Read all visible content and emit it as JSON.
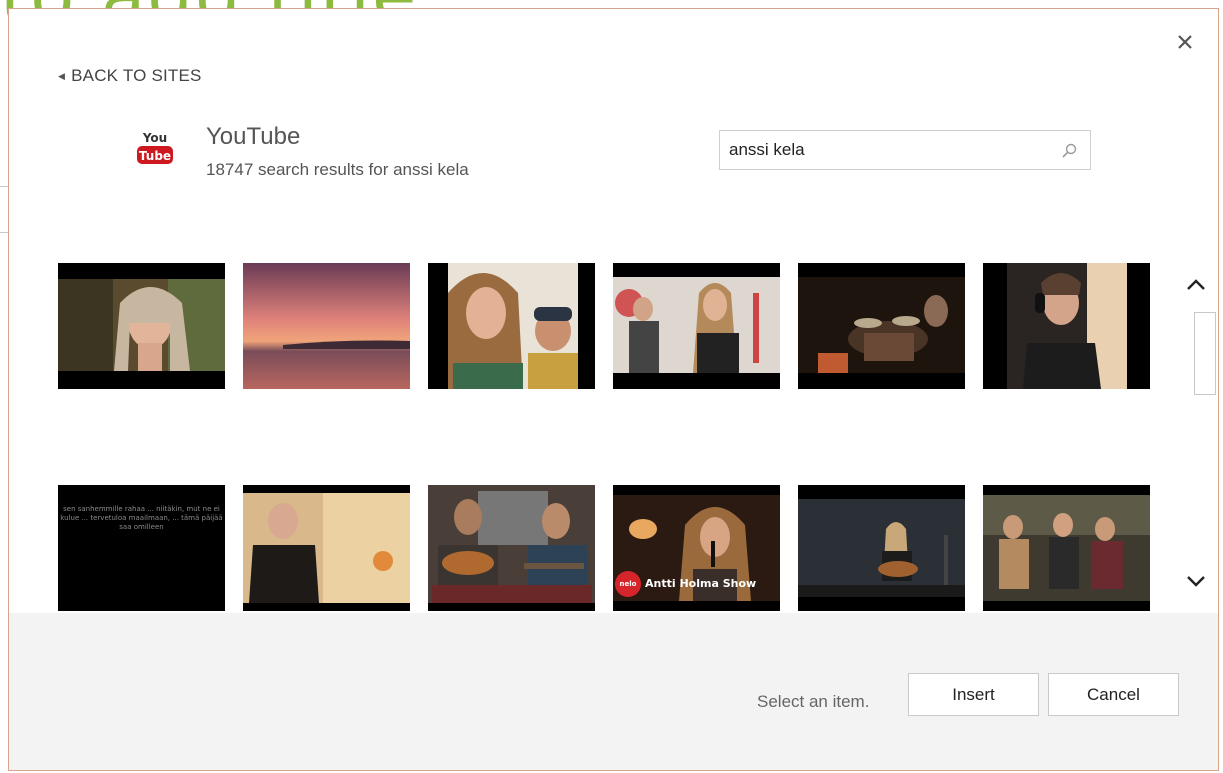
{
  "background": {
    "title_fragment": "to add title"
  },
  "dialog": {
    "back_label": "BACK TO SITES",
    "site": {
      "name": "YouTube",
      "results_text": "18747 search results for anssi kela",
      "logo_you": "You",
      "logo_tube": "Tube"
    },
    "search": {
      "value": "anssi kela",
      "placeholder": ""
    },
    "results": [
      {
        "caption": ""
      },
      {
        "caption": ""
      },
      {
        "caption": ""
      },
      {
        "caption": ""
      },
      {
        "caption": ""
      },
      {
        "caption": ""
      },
      {
        "caption": "sen sanhemmille rahaa ... niitäkin, mut ne ei kulue ... tervetuloa maailmaan, ... tämä päijää saa omilleen"
      },
      {
        "caption": ""
      },
      {
        "caption": ""
      },
      {
        "caption": "Antti Holma Show",
        "badge": "nelo"
      },
      {
        "caption": ""
      },
      {
        "caption": ""
      }
    ],
    "footer": {
      "status": "Select an item.",
      "insert_label": "Insert",
      "cancel_label": "Cancel"
    }
  },
  "colors": {
    "accent_green": "#8dbb3f",
    "youtube_red": "#cc181e",
    "dialog_border": "#d8a48c",
    "footer_bg": "#f3f3f3"
  },
  "icons": [
    "close-icon",
    "back-arrow-icon",
    "youtube-logo-icon",
    "search-icon",
    "chevron-up-icon",
    "chevron-down-icon"
  ]
}
